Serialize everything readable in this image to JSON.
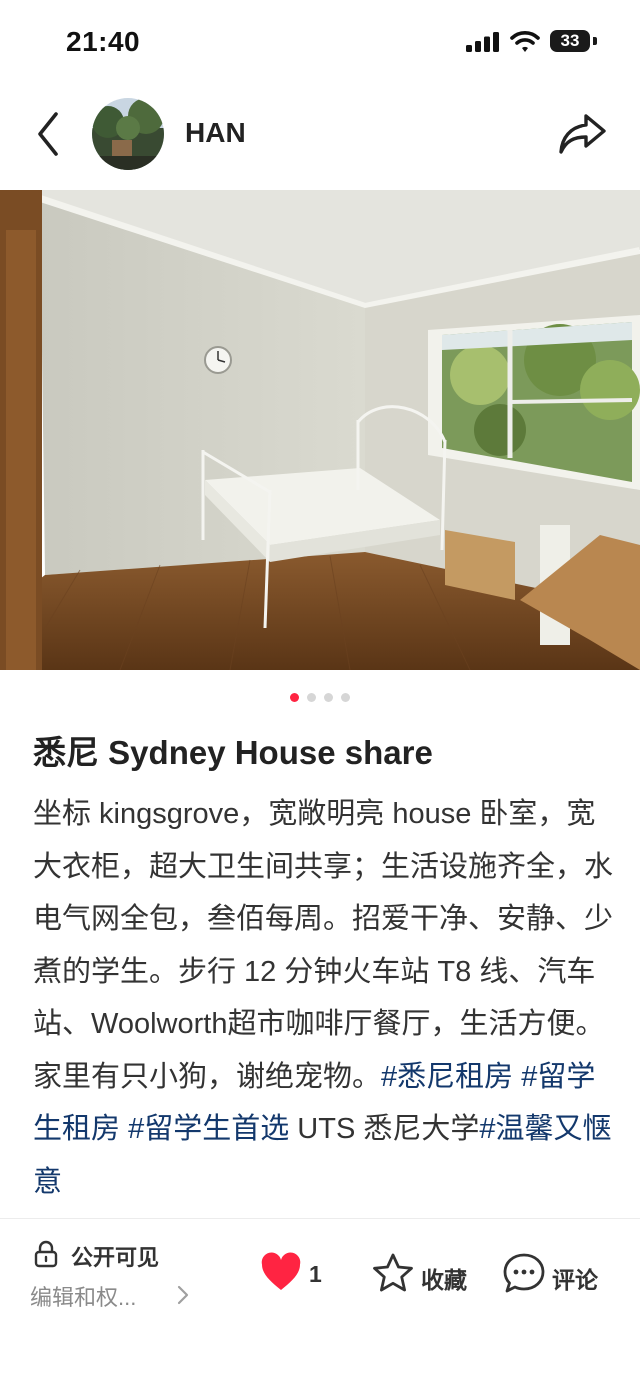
{
  "status": {
    "time": "21:40",
    "battery": "33"
  },
  "header": {
    "username": "HAN"
  },
  "carousel": {
    "total": 4,
    "active_index": 0
  },
  "post": {
    "title": "悉尼 Sydney House share",
    "body_text": "坐标 kingsgrove，宽敞明亮 house 卧室，宽大衣柜，超大卫生间共享；生活设施齐全，水电气网全包，叁佰每周。招爱干净、安静、少煮的学生。步行 12 分钟火车站 T8 线、汽车站、Woolworth超市咖啡厅餐厅，生活方便。家里有只小狗，谢绝宠物。",
    "tags": [
      "#悉尼租房",
      "#留学生租房",
      "#留学生首选"
    ],
    "after_tags_text": "UTS 悉尼大学",
    "tag_last": "#温馨又惬意"
  },
  "bottom": {
    "privacy_label": "公开可见",
    "edit_label": "编辑和权...",
    "like_count": "1",
    "favorite_label": "收藏",
    "comment_label": "评论"
  },
  "colors": {
    "accent": "#ff2442",
    "tag": "#13386c",
    "muted": "#8a8a8a"
  }
}
